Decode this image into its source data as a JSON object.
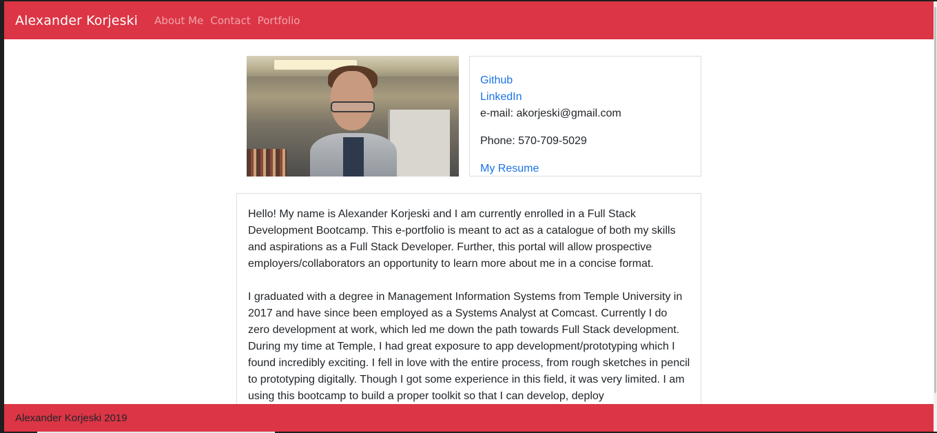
{
  "navbar": {
    "brand": "Alexander Korjeski",
    "links": [
      {
        "label": "About Me"
      },
      {
        "label": "Contact"
      },
      {
        "label": "Portfolio"
      }
    ],
    "color": "#dc3545"
  },
  "photo": {
    "alt": "Profile photo of Alexander Korjeski"
  },
  "contact": {
    "github_label": "Github",
    "linkedin_label": "LinkedIn",
    "email_label": "e-mail: akorjeski@gmail.com",
    "phone_label": "Phone: 570-709-5029",
    "resume_label": "My Resume",
    "link_color": "#1a73e8"
  },
  "about": {
    "paragraphs": [
      "Hello! My name is Alexander Korjeski and I am currently enrolled in a Full Stack Development Bootcamp. This e-portfolio is meant to act as a catalogue of both my skills and aspirations as a Full Stack Developer. Further, this portal will allow prospective employers/collaborators an opportunity to learn more about me in a concise format.",
      "I graduated with a degree in Management Information Systems from Temple University in 2017 and have since been employed as a Systems Analyst at Comcast. Currently I do zero development at work, which led me down the path towards Full Stack development. During my time at Temple, I had great exposure to app development/prototyping which I found incredibly exciting. I fell in love with the entire process, from rough sketches in pencil to prototyping digitally. Though I got some experience in this field, it was very limited. I am using this bootcamp to build a proper toolkit so that I can develop, deploy"
    ]
  },
  "footer": {
    "text": "Alexander Korjeski 2019"
  }
}
